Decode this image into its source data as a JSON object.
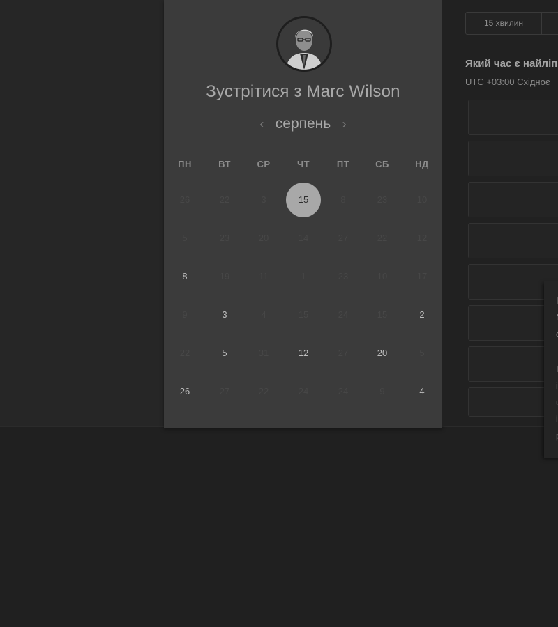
{
  "header": {
    "title": "Зустрітися з Marc Wilson"
  },
  "calendar": {
    "month": "серпень",
    "prev_icon": "‹",
    "next_icon": "›",
    "weekdays": [
      "ПН",
      "ВТ",
      "СР",
      "ЧТ",
      "ПТ",
      "СБ",
      "НД"
    ],
    "weeks": [
      [
        "26",
        "22",
        "3",
        "15",
        "8",
        "23",
        "10"
      ],
      [
        "5",
        "23",
        "20",
        "14",
        "27",
        "22",
        "12"
      ],
      [
        "8",
        "19",
        "11",
        "1",
        "23",
        "10",
        "17"
      ],
      [
        "9",
        "3",
        "4",
        "15",
        "24",
        "15",
        "2"
      ],
      [
        "22",
        "5",
        "31",
        "12",
        "27",
        "20",
        "5"
      ],
      [
        "26",
        "27",
        "22",
        "24",
        "24",
        "9",
        "4"
      ]
    ],
    "selected_day": "15",
    "available_cells": [
      [
        2,
        0
      ],
      [
        3,
        1
      ],
      [
        3,
        6
      ],
      [
        4,
        1
      ],
      [
        4,
        3
      ],
      [
        4,
        5
      ],
      [
        5,
        0
      ],
      [
        5,
        6
      ]
    ]
  },
  "scheduler": {
    "duration_tab": "15 хвилин",
    "question": "Який час є найліп",
    "timezone": "UTC +03:00 Східноє"
  },
  "popover": {
    "lines": [
      "I",
      "N",
      "c",
      "I",
      "i",
      "u",
      "i",
      "p"
    ]
  },
  "colors": {
    "panel": "#3b3b3b",
    "background": "#202020",
    "selected": "#a8a8a8"
  }
}
